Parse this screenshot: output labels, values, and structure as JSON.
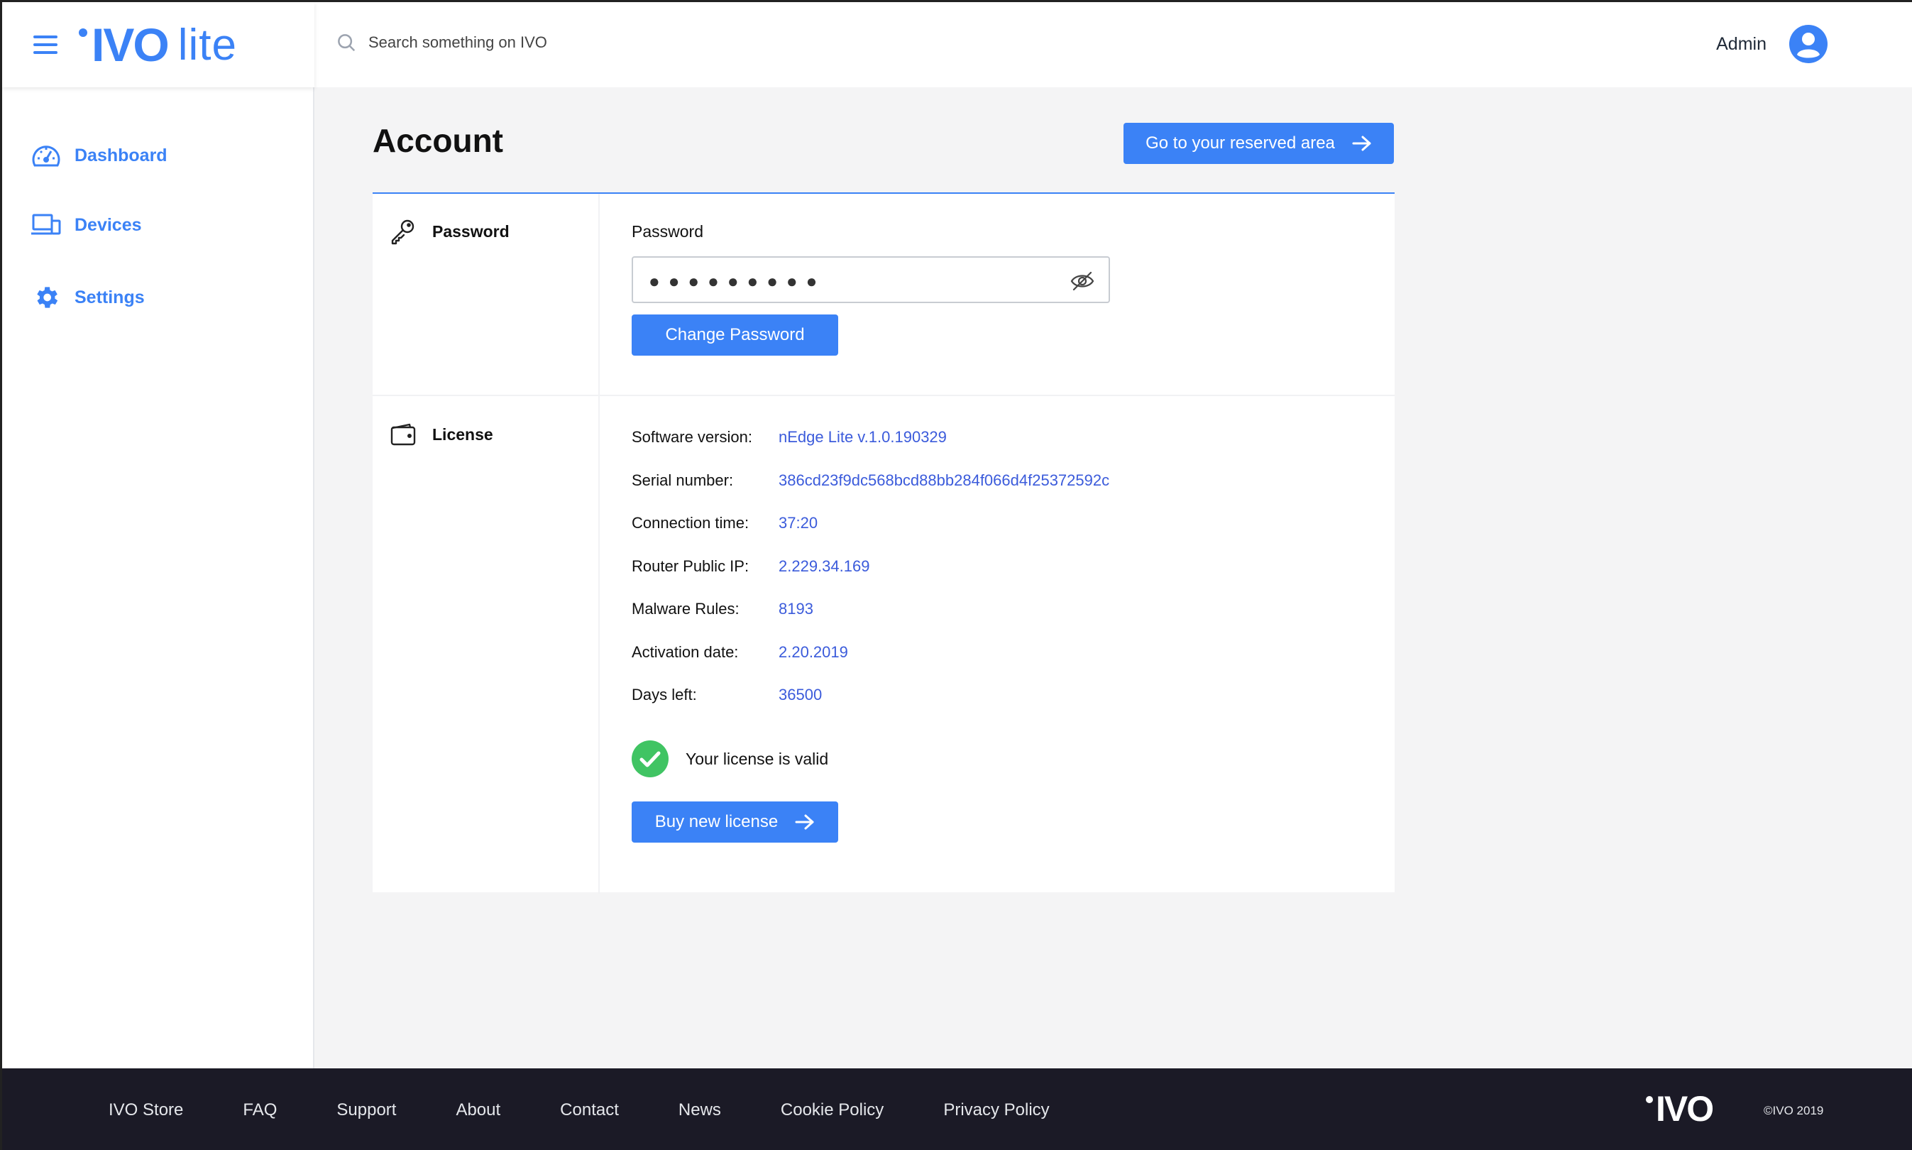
{
  "header": {
    "logo_text": "IVO",
    "logo_suffix": "lite",
    "search_placeholder": "Search something on IVO",
    "user_name": "Admin"
  },
  "sidebar": {
    "items": [
      {
        "label": "Dashboard",
        "icon": "dashboard-gauge-icon"
      },
      {
        "label": "Devices",
        "icon": "devices-icon"
      },
      {
        "label": "Settings",
        "icon": "gear-icon"
      }
    ]
  },
  "main": {
    "title": "Account",
    "reserved_button": "Go to your reserved area",
    "password_section": {
      "label": "Password",
      "field_label": "Password",
      "masked_value": "●●●●●●●●●",
      "change_button": "Change Password"
    },
    "license_section": {
      "label": "License",
      "rows": [
        {
          "key": "Software version:",
          "value": "nEdge Lite v.1.0.190329"
        },
        {
          "key": "Serial number:",
          "value": "386cd23f9dc568bcd88bb284f066d4f25372592c"
        },
        {
          "key": "Connection time:",
          "value": "37:20"
        },
        {
          "key": "Router Public IP:",
          "value": "2.229.34.169"
        },
        {
          "key": "Malware Rules:",
          "value": "8193"
        },
        {
          "key": "Activation date:",
          "value": "2.20.2019"
        },
        {
          "key": "Days left:",
          "value": "36500"
        }
      ],
      "status_text": "Your license is valid",
      "buy_button": "Buy new license"
    }
  },
  "footer": {
    "links": [
      "IVO Store",
      "FAQ",
      "Support",
      "About",
      "Contact",
      "News",
      "Cookie Policy",
      "Privacy Policy"
    ],
    "logo_text": "IVO",
    "copyright": "©IVO 2019"
  },
  "colors": {
    "accent": "#3b82f6",
    "value_text": "#3b5bdb",
    "valid_green": "#40c463",
    "footer_bg": "#1b1a26"
  }
}
